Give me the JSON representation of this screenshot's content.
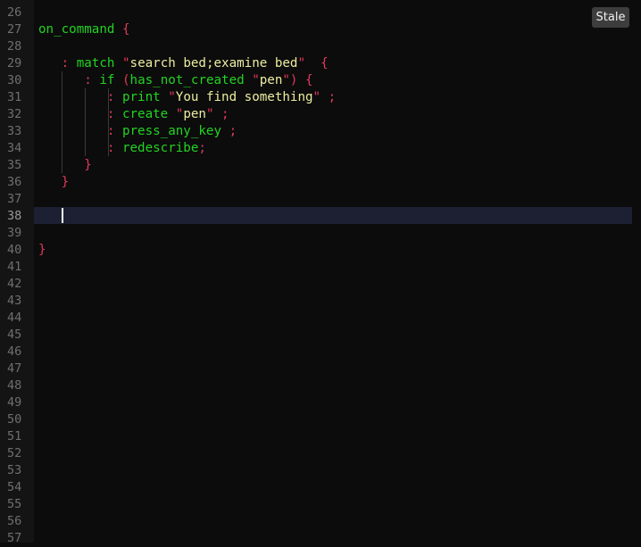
{
  "status_badge": "Stale",
  "colors": {
    "background": "#0c0c0c",
    "gutter": "#141414",
    "line_number": "#6f6f6f",
    "keyword": "#22d322",
    "string": "#ededa0",
    "punctuation": "#e03a5a",
    "active_line": "#1d2033"
  },
  "line_numbers": [
    "26",
    "27",
    "28",
    "29",
    "30",
    "31",
    "32",
    "33",
    "34",
    "35",
    "36",
    "37",
    "38",
    "39",
    "40",
    "41",
    "42",
    "43",
    "44",
    "45",
    "46",
    "47",
    "48",
    "49",
    "50",
    "51",
    "52",
    "53",
    "54",
    "55",
    "56",
    "57"
  ],
  "cursor_line": "38",
  "code": {
    "l27": {
      "kw": "on_command",
      "br": "{"
    },
    "l29": {
      "c": ":",
      "kw": "match",
      "q1": "\"",
      "str": "search bed;examine bed",
      "q2": "\"",
      "br": "{"
    },
    "l30": {
      "c": ":",
      "kw": "if",
      "p1": "(",
      "fn": "has_not_created",
      "q1": "\"",
      "str": "pen",
      "q2": "\"",
      "p2": ")",
      "br": "{"
    },
    "l31": {
      "c": ":",
      "kw": "print",
      "q1": "\"",
      "str": "You find something",
      "q2": "\"",
      "semi": ";"
    },
    "l32": {
      "c": ":",
      "kw": "create",
      "q1": "\"",
      "str": "pen",
      "q2": "\"",
      "semi": ";"
    },
    "l33": {
      "c": ":",
      "kw": "press_any_key",
      "semi": ";"
    },
    "l34": {
      "c": ":",
      "kw": "redescribe",
      "semi": ";"
    },
    "l35": {
      "br": "}"
    },
    "l36": {
      "br": "}"
    },
    "l40": {
      "br": "}"
    }
  }
}
